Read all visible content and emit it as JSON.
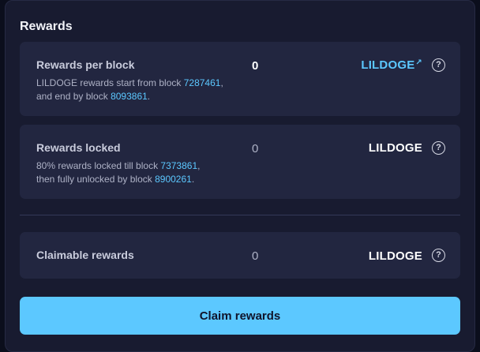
{
  "section": {
    "title": "Rewards"
  },
  "rewards_per_block": {
    "label": "Rewards per block",
    "desc_prefix": "LILDOGE rewards start from block ",
    "start_block": "7287461",
    "desc_mid": ",",
    "desc_line2_prefix": "and end by block ",
    "end_block": "8093861",
    "desc_suffix": ".",
    "value": "0",
    "token": "LILDOGE",
    "token_link_icon": "↗"
  },
  "rewards_locked": {
    "label": "Rewards locked",
    "desc_prefix": "80% rewards locked till block ",
    "lock_block": "7373861",
    "desc_mid": ",",
    "desc_line2_prefix": "then fully unlocked by block ",
    "unlock_block": "8900261",
    "desc_suffix": ".",
    "value": "0",
    "token": "LILDOGE"
  },
  "claimable": {
    "label": "Claimable rewards",
    "value": "0",
    "token": "LILDOGE"
  },
  "help_icon_glyph": "?",
  "claim_button": {
    "label": "Claim rewards"
  },
  "colors": {
    "accent": "#5cc8ff",
    "panel": "#181b30",
    "card": "#222640",
    "text": "#ffffff"
  }
}
